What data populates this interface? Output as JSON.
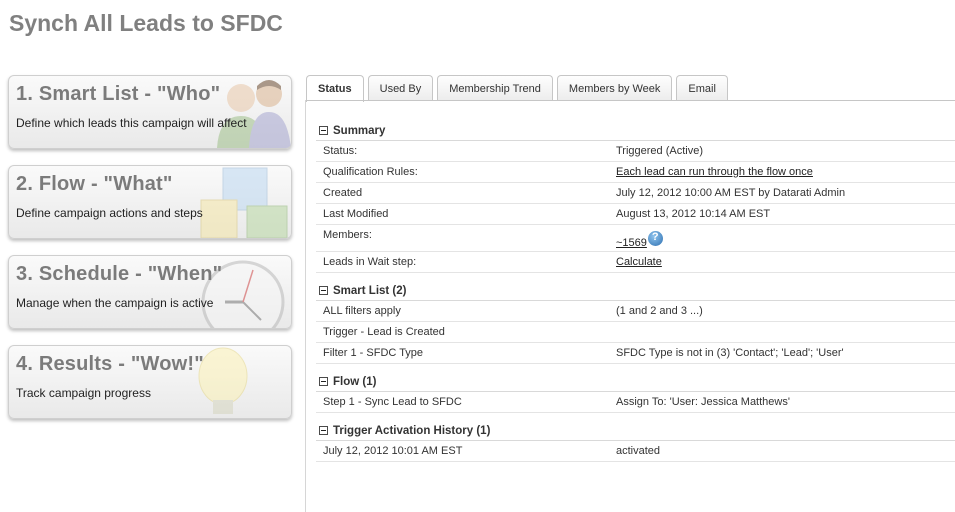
{
  "page": {
    "title": "Synch All Leads to SFDC"
  },
  "steps": [
    {
      "title": "1. Smart List - \"Who\"",
      "desc": "Define which leads this campaign will affect",
      "icon": "people-icon"
    },
    {
      "title": "2. Flow - \"What\"",
      "desc": "Define campaign actions and steps",
      "icon": "blocks-icon"
    },
    {
      "title": "3. Schedule - \"When\"",
      "desc": "Manage when the campaign is active",
      "icon": "clock-icon"
    },
    {
      "title": "4. Results - \"Wow!\"",
      "desc": "Track campaign progress",
      "icon": "lightbulb-icon"
    }
  ],
  "tabs": [
    {
      "label": "Status",
      "active": true
    },
    {
      "label": "Used By",
      "active": false
    },
    {
      "label": "Membership Trend",
      "active": false
    },
    {
      "label": "Members by Week",
      "active": false
    },
    {
      "label": "Email",
      "active": false
    }
  ],
  "summary": {
    "header": "Summary",
    "rows": [
      {
        "label": "Status:",
        "value": "Triggered (Active)"
      },
      {
        "label": "Qualification Rules:",
        "value": "Each lead can run through the flow once",
        "link": true
      },
      {
        "label": "Created",
        "value": "July 12, 2012 10:00 AM EST by Datarati Admin"
      },
      {
        "label": "Last Modified",
        "value": "August 13, 2012 10:14 AM EST"
      },
      {
        "label": "Members:",
        "value": "~1569",
        "link": true
      },
      {
        "label": "Leads in Wait step:",
        "value": "Calculate",
        "link": true
      }
    ]
  },
  "smart_list": {
    "header": "Smart List (2)",
    "rows": [
      {
        "label": "ALL filters apply",
        "value": "(1 and 2 and 3 ...)"
      },
      {
        "label": "Trigger - Lead is Created",
        "value": ""
      },
      {
        "label": "Filter 1 - SFDC Type",
        "value": "SFDC Type is not in (3) 'Contact'; 'Lead'; 'User'"
      }
    ]
  },
  "flow": {
    "header": "Flow (1)",
    "rows": [
      {
        "label": "Step 1 - Sync Lead to SFDC",
        "value": "Assign To: 'User: Jessica Matthews'"
      }
    ]
  },
  "trigger_history": {
    "header": "Trigger Activation History (1)",
    "rows": [
      {
        "label": "July 12, 2012 10:01 AM EST",
        "value": "activated"
      }
    ]
  },
  "colors": {
    "title": "#808080",
    "step_title": "#7b7b7b",
    "refresh_icon": "#2d6fb0"
  }
}
